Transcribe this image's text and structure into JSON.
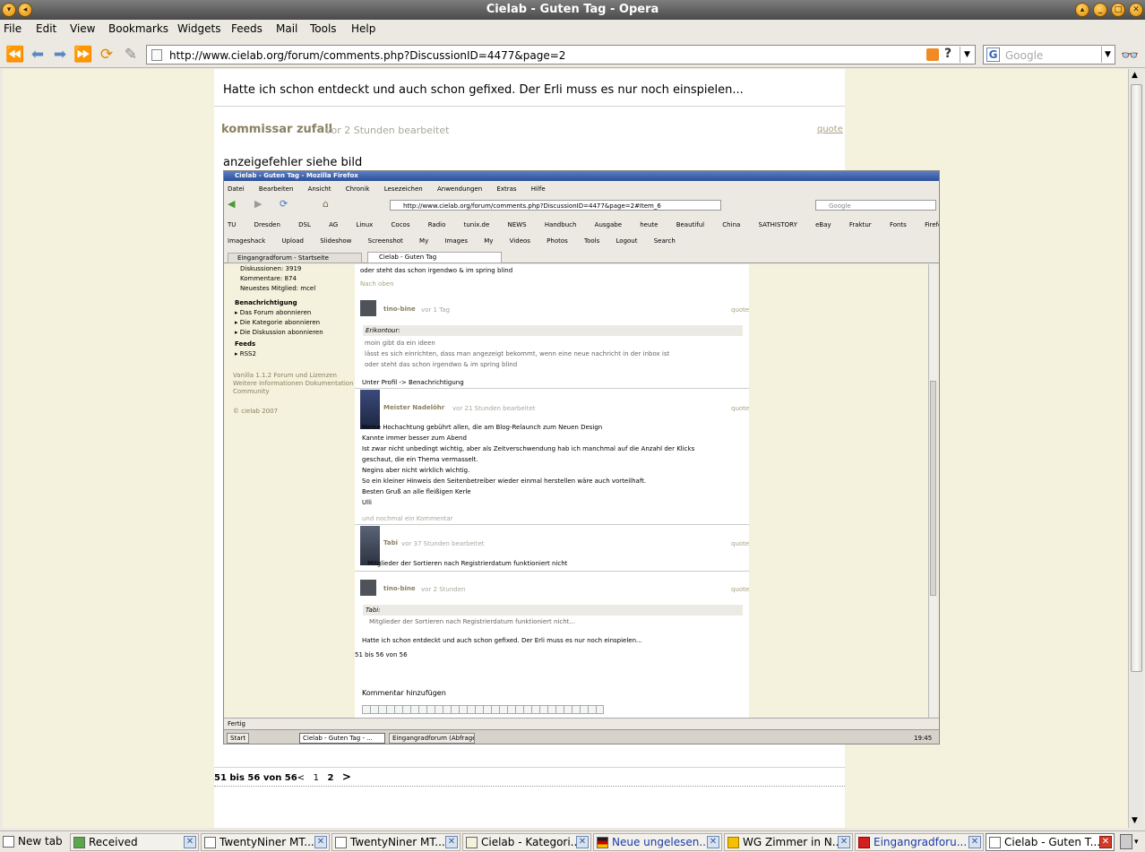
{
  "window": {
    "title": "Cielab - Guten Tag - Opera"
  },
  "menu": [
    "File",
    "Edit",
    "View",
    "Bookmarks",
    "Widgets",
    "Feeds",
    "Mail",
    "Tools",
    "Help"
  ],
  "address": {
    "url": "http://www.cielab.org/forum/comments.php?DiscussionID=4477&page=2"
  },
  "search": {
    "placeholder": "Google"
  },
  "page": {
    "top_comment": "Hatte ich schon entdeckt und auch schon gefixed. Der Erli muss es nur noch einspielen...",
    "author": "kommissar zufall",
    "meta": "vor 2 Stunden bearbeitet",
    "quote_label": "quote",
    "body": "anzeigefehler siehe bild",
    "pagination_text": "51 bis 56 von 56",
    "pagination_prev": "<",
    "pagination_pages": [
      "1",
      "2"
    ],
    "pagination_next": ">"
  },
  "screenshot": {
    "window_title": "Cielab - Guten Tag - Mozilla Firefox",
    "menu": [
      "Datei",
      "Bearbeiten",
      "Ansicht",
      "Chronik",
      "Lesezeichen",
      "Anwendungen",
      "Extras",
      "Hilfe"
    ],
    "url": "http://www.cielab.org/forum/comments.php?DiscussionID=4477&page=2#Item_6",
    "search": "Google",
    "bookmarks": [
      "TU Dresden",
      "DSL AG",
      "Linux",
      "Cocos",
      "Radio",
      "tunix.de",
      "NEWS",
      "Handbuch",
      "Ausgabe heute",
      "Beautiful China",
      "SATHISTORY",
      "eBay",
      "Fraktur",
      "Fonts",
      "Firefox"
    ],
    "toolbar2": [
      "Imageshack",
      "Upload",
      "Slideshow",
      "Screenshot",
      "My Images",
      "My Videos",
      "Photos",
      "Tools",
      "Logout"
    ],
    "toolbar2_search": "Search",
    "tabs": [
      "Eingangradforum - Startseite",
      "Cielab - Guten Tag"
    ],
    "sidebar": [
      "Diskussionen: 3919",
      "Kommentare: 874",
      "Neuestes Mitglied: mcel",
      "Benachrichtigung",
      "Das Forum abonnieren",
      "Die Kategorie abonnieren",
      "Die Diskussion abonnieren",
      "Feeds",
      "RSS2",
      "Vanilla 1.1.2 Forum und Lizenzen",
      "Weitere Informationen",
      "Dokumentation",
      "Community",
      "© cielab 2007"
    ],
    "top_line": "oder steht das schon irgendwo & im spring blind",
    "top_link": "Nach oben",
    "posts": [
      {
        "author": "tino-bine",
        "meta": "vor 1 Tag",
        "quote": "quote",
        "quote_head": "Erikontour:",
        "quote_lines": [
          "moin gibt da ein ideen",
          "lässt es sich einrichten, dass man angezeigt bekommt, wenn eine neue nachricht in der inbox ist",
          "oder steht das schon irgendwo & im spring blind"
        ],
        "after": "Unter Profil -> Benachrichtigung"
      },
      {
        "author": "Meister Nadelöhr",
        "meta": "vor 21 Stunden bearbeitet",
        "quote": "quote",
        "lines": [
          "Meine Hochachtung gebührt allen, die am Blog-Relaunch zum Neuen Design",
          "Kannte immer besser zum Abend",
          "Ist zwar nicht unbedingt wichtig, aber als Zeitverschwendung hab ich manchmal auf die Anzahl der Klicks",
          "geschaut, die ein Thema vermasselt.",
          "Negins aber nicht wirklich wichtig.",
          "So ein kleiner Hinweis den Seitenbetreiber wieder einmal herstellen wäre auch vorteilhaft.",
          "Besten Gruß an alle fleißigen Kerle",
          "Ulli"
        ],
        "footer": "und nochmal ein Kommentar"
      },
      {
        "author": "Tabi",
        "meta": "vor 37 Stunden bearbeitet",
        "quote": "quote",
        "lines": [
          "Mitglieder der Sortieren nach Registrierdatum funktioniert nicht"
        ]
      },
      {
        "author": "tino-bine",
        "meta": "vor 2 Stunden",
        "quote": "quote",
        "quote_head": "Tabi:",
        "quote_lines": [
          "Mitglieder der Sortieren nach Registrierdatum funktioniert nicht..."
        ],
        "after": "Hatte ich schon entdeckt und auch schon gefixed. Der Erli muss es nur noch einspielen..."
      }
    ],
    "pages": "51 bis 56 von 56",
    "add_comment": "Kommentar hinzufügen",
    "status": "Fertig",
    "task_start": "Start",
    "task_items": [
      "Cielab - Guten Tag - ...",
      "Eingangradforum (Abfrage)..."
    ],
    "clock": "19:45"
  },
  "taskbar": {
    "new_tab": "New tab",
    "tabs": [
      "Received",
      "TwentyNiner MT...",
      "TwentyNiner MT...",
      "Cielab - Kategori...",
      "Neue ungelesen...",
      "WG Zimmer in N...",
      "Eingangradforu...",
      "Cielab - Guten T..."
    ]
  },
  "colors": {
    "author": "#8a8161",
    "meta": "#a9a69c",
    "link": "#a8a27f",
    "beige": "#f4f1dc"
  }
}
